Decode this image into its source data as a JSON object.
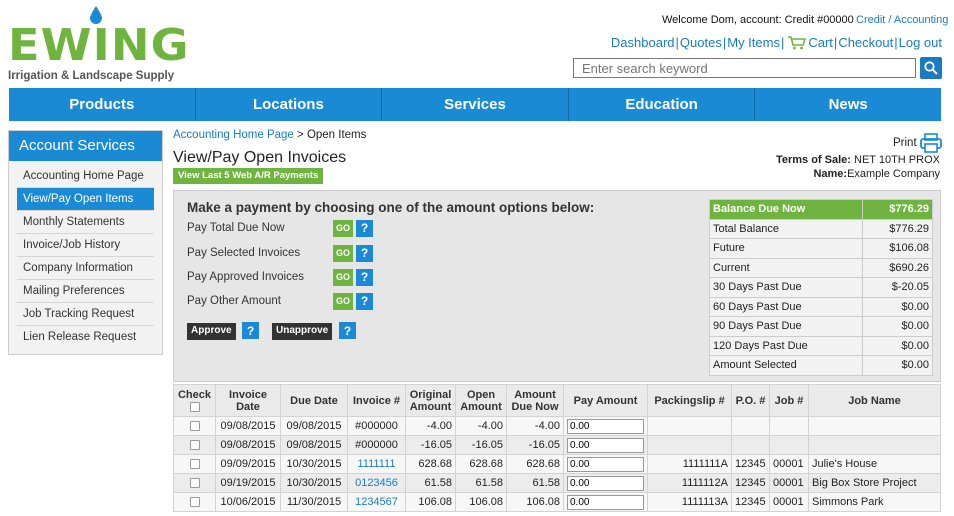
{
  "brand": {
    "logo_text": "EWING",
    "tagline": "Irrigation & Landscape Supply",
    "color": "#6fb43f"
  },
  "account": {
    "welcome": "Welcome Dom, account: Credit #00000",
    "credit_link": "Credit / Accounting"
  },
  "topnav": {
    "dashboard": "Dashboard",
    "quotes": "Quotes",
    "my_items": "My Items",
    "cart": "Cart",
    "checkout": "Checkout",
    "logout": "Log out"
  },
  "search": {
    "placeholder": "Enter search keyword"
  },
  "mainnav": [
    "Products",
    "Locations",
    "Services",
    "Education",
    "News"
  ],
  "sidebar": {
    "title": "Account Services",
    "items": [
      "Accounting Home Page",
      "View/Pay Open Items",
      "Monthly Statements",
      "Invoice/Job History",
      "Company Information",
      "Mailing Preferences",
      "Job Tracking Request",
      "Lien Release Request"
    ],
    "active_index": 1
  },
  "breadcrumb": {
    "home": "Accounting Home Page",
    "sep": " > ",
    "current": "Open Items"
  },
  "page": {
    "title": "View/Pay Open Invoices",
    "last_payments_button": "View Last 5 Web A/R Payments",
    "print": "Print",
    "terms_label": "Terms of Sale:",
    "terms_value": "NET 10TH PROX",
    "name_label": "Name:",
    "name_value": "Example Company"
  },
  "payment": {
    "heading": "Make a payment by choosing one of the amount options below:",
    "options": [
      "Pay Total Due Now",
      "Pay Selected Invoices",
      "Pay Approved Invoices",
      "Pay Other Amount"
    ],
    "go_label": "GO",
    "help_label": "?",
    "approve": "Approve",
    "unapprove": "Unapprove"
  },
  "balance": {
    "header": {
      "label": "Balance Due Now",
      "value": "$776.29"
    },
    "rows": [
      {
        "label": "Total Balance",
        "value": "$776.29"
      },
      {
        "label": "Future",
        "value": "$106.08"
      },
      {
        "label": "Current",
        "value": "$690.26"
      },
      {
        "label": "30 Days Past Due",
        "value": "$-20.05"
      },
      {
        "label": "60 Days Past Due",
        "value": "$0.00"
      },
      {
        "label": "90 Days Past Due",
        "value": "$0.00"
      },
      {
        "label": "120 Days Past Due",
        "value": "$0.00"
      },
      {
        "label": "Amount Selected",
        "value": "$0.00"
      }
    ]
  },
  "invoices": {
    "headers": {
      "check": "Check",
      "invoice_date": "Invoice Date",
      "due_date": "Due Date",
      "invoice_no": "Invoice #",
      "original": "Original Amount",
      "open": "Open Amount",
      "due_now": "Amount Due Now",
      "pay": "Pay Amount",
      "packing": "Packingslip #",
      "po": "P.O. #",
      "job": "Job #",
      "job_name": "Job Name"
    },
    "rows": [
      {
        "invoice_date": "09/08/2015",
        "due_date": "09/08/2015",
        "invoice_no": "#000000",
        "link": false,
        "original": "-4.00",
        "open": "-4.00",
        "due_now": "-4.00",
        "pay": "0.00",
        "packing": "",
        "po": "",
        "job": "",
        "job_name": ""
      },
      {
        "invoice_date": "09/08/2015",
        "due_date": "09/08/2015",
        "invoice_no": "#000000",
        "link": false,
        "original": "-16.05",
        "open": "-16.05",
        "due_now": "-16.05",
        "pay": "0.00",
        "packing": "",
        "po": "",
        "job": "",
        "job_name": ""
      },
      {
        "invoice_date": "09/09/2015",
        "due_date": "10/30/2015",
        "invoice_no": "1111111",
        "link": true,
        "original": "628.68",
        "open": "628.68",
        "due_now": "628.68",
        "pay": "0.00",
        "packing": "1111111A",
        "po": "12345",
        "job": "00001",
        "job_name": "Julie's House"
      },
      {
        "invoice_date": "09/19/2015",
        "due_date": "10/30/2015",
        "invoice_no": "0123456",
        "link": true,
        "original": "61.58",
        "open": "61.58",
        "due_now": "61.58",
        "pay": "0.00",
        "packing": "1111112A",
        "po": "12345",
        "job": "00001",
        "job_name": "Big Box Store Project"
      },
      {
        "invoice_date": "10/06/2015",
        "due_date": "11/30/2015",
        "invoice_no": "1234567",
        "link": true,
        "original": "106.08",
        "open": "106.08",
        "due_now": "106.08",
        "pay": "0.00",
        "packing": "1111113A",
        "po": "12345",
        "job": "00001",
        "job_name": "Simmons Park"
      }
    ]
  },
  "colors": {
    "nav_blue": "#1a8ad4",
    "link_blue": "#1a7bc4",
    "green": "#6fb43f",
    "dark_button": "#333333"
  }
}
